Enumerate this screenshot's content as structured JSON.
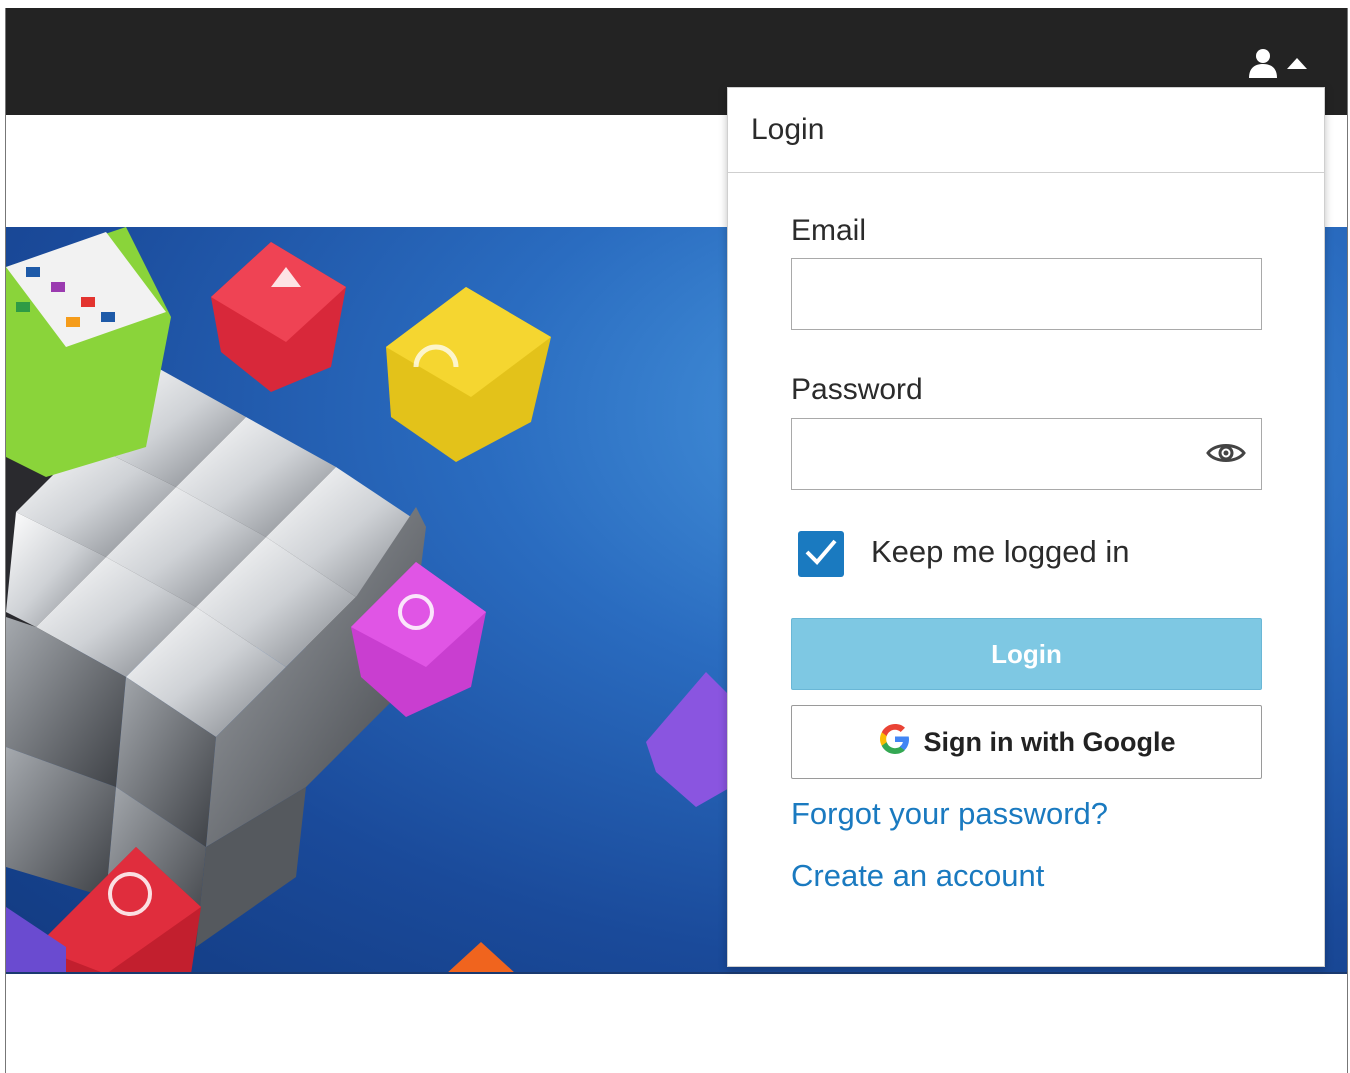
{
  "header": {
    "user_menu_icon": "user-icon",
    "caret_icon": "caret-up-icon"
  },
  "login": {
    "title": "Login",
    "email_label": "Email",
    "email_value": "",
    "password_label": "Password",
    "password_value": "",
    "password_toggle_icon": "eye-icon",
    "keep_logged_in": {
      "label": "Keep me logged in",
      "checked": true
    },
    "login_button": "Login",
    "google_button": "Sign in with Google",
    "forgot_link": "Forgot your password?",
    "create_link": "Create an account"
  },
  "colors": {
    "topbar": "#232323",
    "link": "#1a7ac0",
    "login_button": "#7ec8e3",
    "checkbox": "#1a7ac0"
  }
}
